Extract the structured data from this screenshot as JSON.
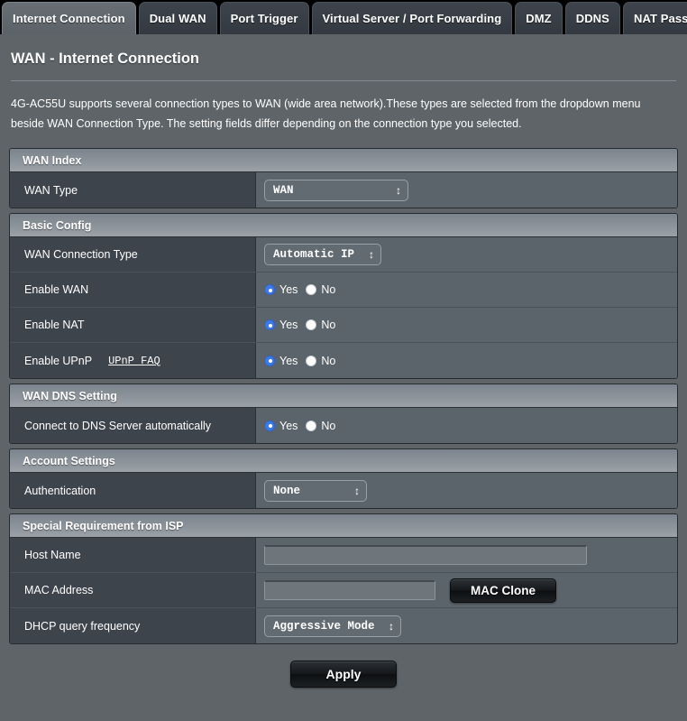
{
  "tabs": [
    {
      "label": "Internet Connection",
      "active": true
    },
    {
      "label": "Dual WAN",
      "active": false
    },
    {
      "label": "Port Trigger",
      "active": false
    },
    {
      "label": "Virtual Server / Port Forwarding",
      "active": false
    },
    {
      "label": "DMZ",
      "active": false
    },
    {
      "label": "DDNS",
      "active": false
    },
    {
      "label": "NAT Passthrough",
      "active": false
    }
  ],
  "header": {
    "title": "WAN - Internet Connection",
    "description": "4G-AC55U supports several connection types to WAN (wide area network).These types are selected from the dropdown menu beside WAN Connection Type. The setting fields differ depending on the connection type you selected."
  },
  "sections": {
    "wan_index": {
      "title": "WAN Index",
      "wan_type": {
        "label": "WAN Type",
        "value": "WAN"
      }
    },
    "basic_config": {
      "title": "Basic Config",
      "wan_connection_type": {
        "label": "WAN Connection Type",
        "value": "Automatic IP"
      },
      "enable_wan": {
        "label": "Enable WAN",
        "yes": "Yes",
        "no": "No",
        "selected": "Yes"
      },
      "enable_nat": {
        "label": "Enable NAT",
        "yes": "Yes",
        "no": "No",
        "selected": "Yes"
      },
      "enable_upnp": {
        "label": "Enable UPnP",
        "link": "UPnP  FAQ",
        "yes": "Yes",
        "no": "No",
        "selected": "Yes"
      }
    },
    "wan_dns": {
      "title": "WAN DNS Setting",
      "connect_dns_auto": {
        "label": "Connect to DNS Server automatically",
        "yes": "Yes",
        "no": "No",
        "selected": "Yes"
      }
    },
    "account_settings": {
      "title": "Account Settings",
      "authentication": {
        "label": "Authentication",
        "value": "None"
      }
    },
    "special_isp": {
      "title": "Special Requirement from ISP",
      "host_name": {
        "label": "Host Name",
        "value": "",
        "placeholder": ""
      },
      "mac_address": {
        "label": "MAC Address",
        "value": "",
        "placeholder": "",
        "clone_button": "MAC Clone"
      },
      "dhcp_query": {
        "label": "DHCP query frequency",
        "value": "Aggressive Mode"
      }
    }
  },
  "footer": {
    "apply_label": "Apply"
  },
  "colors": {
    "accent_radio": "#3e7ae6",
    "page_background": "#5e6468",
    "label_cell": "#3e444c",
    "value_cell": "#5b646b",
    "section_header_top": "#7b838c",
    "section_header_bottom": "#9aa1a7",
    "tabbar_background": "#000000"
  }
}
